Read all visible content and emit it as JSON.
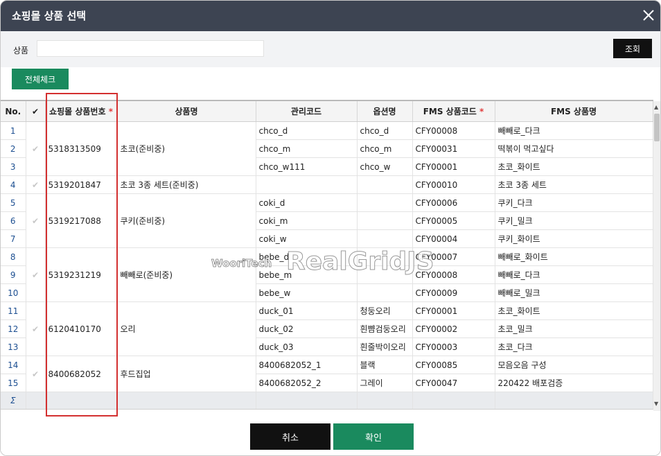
{
  "dialog": {
    "title": "쇼핑몰 상품 선택"
  },
  "search": {
    "label": "상품",
    "value": "",
    "button": "조회"
  },
  "toolbar": {
    "check_all": "전체체크"
  },
  "columns": {
    "no": "No.",
    "check": "✔",
    "mall_product_no": "쇼핑몰 상품번호",
    "product_name": "상품명",
    "mgmt_code": "관리코드",
    "option_name": "옵션명",
    "fms_code": "FMS 상품코드",
    "fms_name": "FMS 상품명",
    "required_mark": "*"
  },
  "groups": [
    {
      "mall_no": "5318313509",
      "name": "초코(준비중)",
      "rows": [
        {
          "no": "1",
          "code": "chco_d",
          "option": "chco_d",
          "fms_code": "CFY00008",
          "fms_name": "빼빼로_다크"
        },
        {
          "no": "2",
          "code": "chco_m",
          "option": "chco_m",
          "fms_code": "CFY00031",
          "fms_name": "떡볶이 먹고싶다"
        },
        {
          "no": "3",
          "code": "chco_w111",
          "option": "chco_w",
          "fms_code": "CFY00001",
          "fms_name": "초코_화이트"
        }
      ]
    },
    {
      "mall_no": "5319201847",
      "name": "초코 3종 세트(준비중)",
      "rows": [
        {
          "no": "4",
          "code": "",
          "option": "",
          "fms_code": "CFY00010",
          "fms_name": "초코 3종 세트"
        }
      ]
    },
    {
      "mall_no": "5319217088",
      "name": "쿠키(준비중)",
      "rows": [
        {
          "no": "5",
          "code": "coki_d",
          "option": "",
          "fms_code": "CFY00006",
          "fms_name": "쿠키_다크"
        },
        {
          "no": "6",
          "code": "coki_m",
          "option": "",
          "fms_code": "CFY00005",
          "fms_name": "쿠키_밀크"
        },
        {
          "no": "7",
          "code": "coki_w",
          "option": "",
          "fms_code": "CFY00004",
          "fms_name": "쿠키_화이트"
        }
      ]
    },
    {
      "mall_no": "5319231219",
      "name": "빼빼로(준비중)",
      "rows": [
        {
          "no": "8",
          "code": "bebe_d",
          "option": "",
          "fms_code": "CFY00007",
          "fms_name": "빼빼로_화이트"
        },
        {
          "no": "9",
          "code": "bebe_m",
          "option": "",
          "fms_code": "CFY00008",
          "fms_name": "빼빼로_다크"
        },
        {
          "no": "10",
          "code": "bebe_w",
          "option": "",
          "fms_code": "CFY00009",
          "fms_name": "빼빼로_밀크"
        }
      ]
    },
    {
      "mall_no": "6120410170",
      "name": "오리",
      "rows": [
        {
          "no": "11",
          "code": "duck_01",
          "option": "청둥오리",
          "fms_code": "CFY00001",
          "fms_name": "초코_화이트"
        },
        {
          "no": "12",
          "code": "duck_02",
          "option": "흰뺨검둥오리",
          "fms_code": "CFY00002",
          "fms_name": "초코_밀크"
        },
        {
          "no": "13",
          "code": "duck_03",
          "option": "흰줄박이오리",
          "fms_code": "CFY00003",
          "fms_name": "초코_다크"
        }
      ]
    },
    {
      "mall_no": "8400682052",
      "name": "후드집업",
      "rows": [
        {
          "no": "14",
          "code": "8400682052_1",
          "option": "블랙",
          "fms_code": "CFY00085",
          "fms_name": "모음오음 구성"
        },
        {
          "no": "15",
          "code": "8400682052_2",
          "option": "그레이",
          "fms_code": "CFY00047",
          "fms_name": "220422 배포검증"
        }
      ]
    }
  ],
  "summary": {
    "sigma": "Σ"
  },
  "watermark": {
    "brand": "WooriTech",
    "product": "RealGridJS"
  },
  "footer": {
    "cancel": "취소",
    "confirm": "확인"
  },
  "colors": {
    "titlebar": "#3d4452",
    "accent_green": "#1a8a5e",
    "highlight_red": "#d32f2f"
  }
}
